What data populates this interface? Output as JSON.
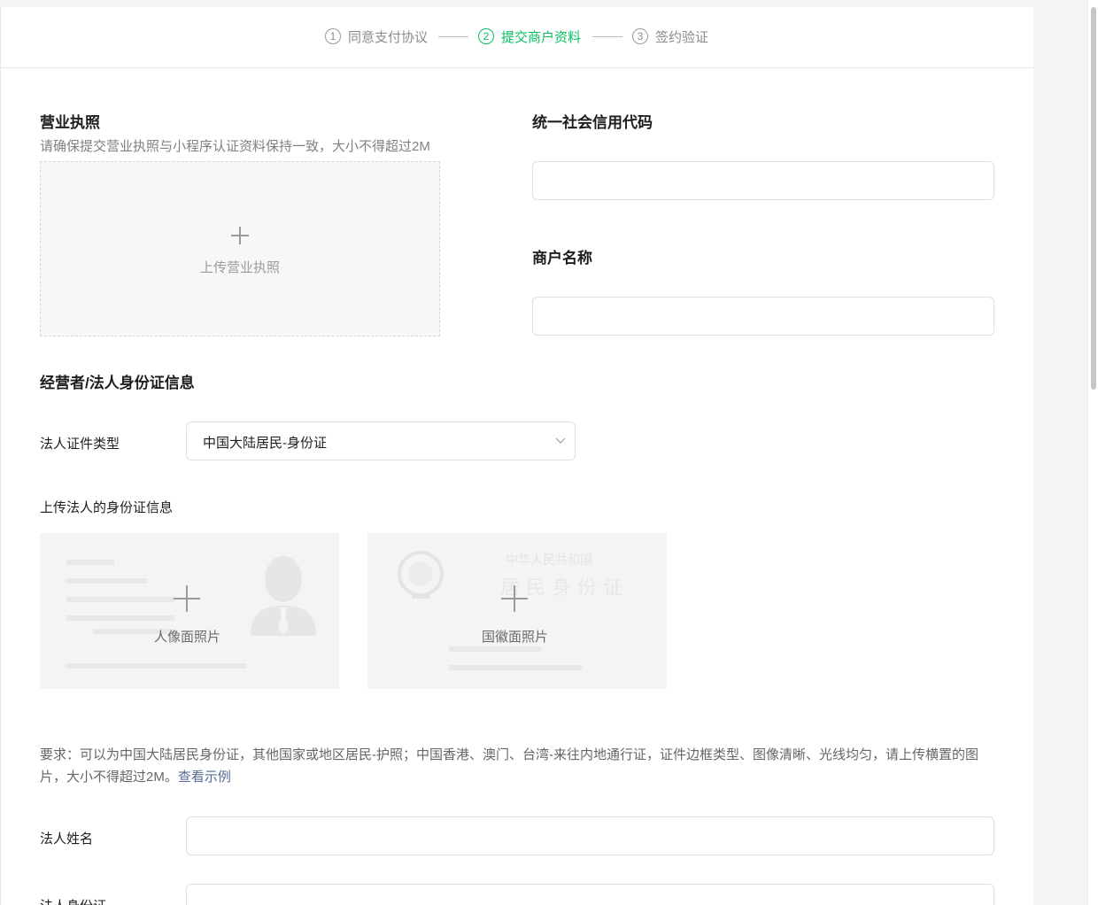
{
  "steps": [
    {
      "num": "1",
      "label": "同意支付协议"
    },
    {
      "num": "2",
      "label": "提交商户资料"
    },
    {
      "num": "3",
      "label": "签约验证"
    }
  ],
  "license": {
    "title": "营业执照",
    "hint": "请确保提交营业执照与小程序认证资料保持一致，大小不得超过2M",
    "upload_label": "上传营业执照"
  },
  "credit_code": {
    "title": "统一社会信用代码",
    "value": ""
  },
  "merchant_name": {
    "title": "商户名称",
    "value": ""
  },
  "legal_id": {
    "title": "经营者/法人身份证信息",
    "type_label": "法人证件类型",
    "type_value": "中国大陆居民-身份证",
    "upload_title": "上传法人的身份证信息",
    "front_label": "人像面照片",
    "back_label": "国徽面照片",
    "back_card_heading": "中华人民共和国",
    "back_card_subheading": "居 民 身 份 证",
    "requirement": "要求：可以为中国大陆居民身份证，其他国家或地区居民-护照；中国香港、澳门、台湾-来往内地通行证，证件边框类型、图像清晰、光线均匀，请上传横置的图片，大小不得超过2M。",
    "example_link": "查看示例",
    "name_label": "法人姓名",
    "name_value": "",
    "id_label": "法人身份证",
    "id_value": ""
  },
  "colors": {
    "accent": "#07c160",
    "link": "#576b95"
  }
}
